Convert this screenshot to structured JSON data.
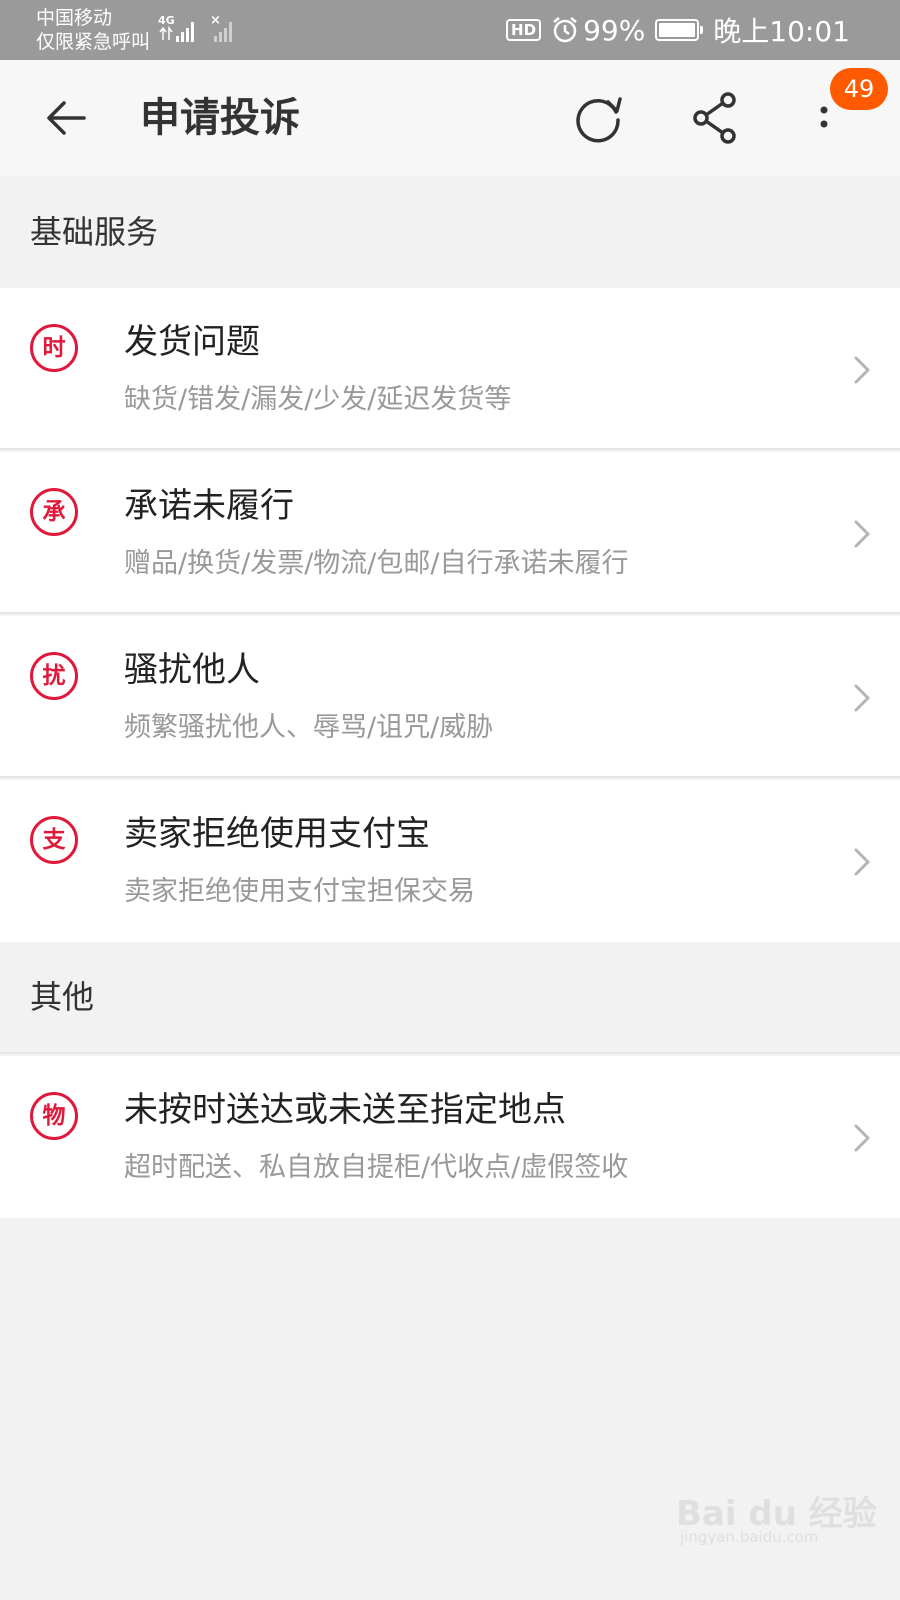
{
  "status_bar": {
    "carrier_line1": "中国移动",
    "carrier_line2": "仅限紧急呼叫",
    "network": "4G",
    "hd_label": "HD",
    "battery_percent": "99%",
    "time": "晚上10:01"
  },
  "header": {
    "title": "申请投诉",
    "badge_count": "49"
  },
  "sections": [
    {
      "title": "基础服务",
      "items": [
        {
          "icon_char": "时",
          "title": "发货问题",
          "subtitle": "缺货/错发/漏发/少发/延迟发货等"
        },
        {
          "icon_char": "承",
          "title": "承诺未履行",
          "subtitle": "赠品/换货/发票/物流/包邮/自行承诺未履行"
        },
        {
          "icon_char": "扰",
          "title": "骚扰他人",
          "subtitle": "频繁骚扰他人、辱骂/诅咒/威胁"
        },
        {
          "icon_char": "支",
          "title": "卖家拒绝使用支付宝",
          "subtitle": "卖家拒绝使用支付宝担保交易"
        }
      ]
    },
    {
      "title": "其他",
      "items": [
        {
          "icon_char": "物",
          "title": "未按时送达或未送至指定地点",
          "subtitle": "超时配送、私自放自提柜/代收点/虚假签收"
        }
      ]
    }
  ],
  "watermark": {
    "text": "Bai du 经验",
    "url": "jingyan.baidu.com"
  },
  "colors": {
    "accent": "#e0193a",
    "badge": "#ff5a00",
    "status_bar": "#9a9a9a"
  }
}
